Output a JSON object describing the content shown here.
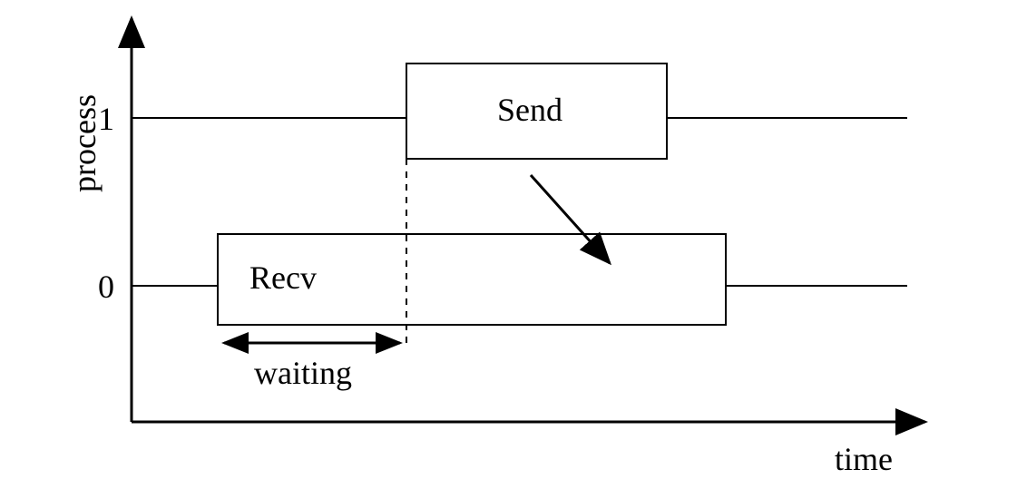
{
  "chart_data": {
    "type": "timeline",
    "title": "",
    "xlabel": "time",
    "ylabel": "process",
    "y_ticks": [
      "0",
      "1"
    ],
    "processes": [
      {
        "id": 1,
        "label": "1",
        "events": [
          {
            "name": "Send",
            "start": 0.43,
            "end": 0.73
          }
        ]
      },
      {
        "id": 0,
        "label": "0",
        "events": [
          {
            "name": "Recv",
            "start": 0.23,
            "end": 0.8,
            "waiting_until": 0.43
          }
        ]
      }
    ],
    "arrows": [
      {
        "from_process": 1,
        "to_process": 0,
        "from_x": 0.55,
        "to_x": 0.64
      }
    ],
    "annotations": [
      {
        "label": "waiting",
        "process": 0,
        "start": 0.23,
        "end": 0.43
      }
    ]
  },
  "labels": {
    "y_axis_title": "process",
    "x_axis_title": "time",
    "tick_1": "1",
    "tick_0": "0",
    "send_box": "Send",
    "recv_box": "Recv",
    "waiting": "waiting"
  }
}
